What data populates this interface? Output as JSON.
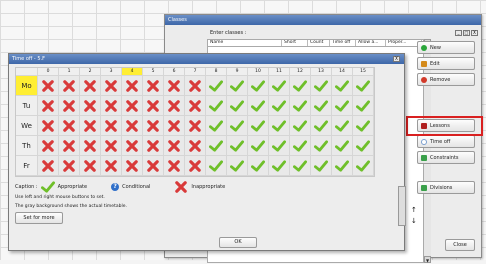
{
  "classes_window": {
    "title": "Classes",
    "enter_label": "Enter classes :",
    "columns": [
      "Name",
      "Short",
      "Count",
      "Time off",
      "Allow a...",
      "Proper..."
    ],
    "title_buttons": [
      "_",
      "□",
      "X"
    ],
    "toolbar_buttons": [
      "_",
      "□",
      "X"
    ],
    "side_buttons": [
      {
        "label": "New",
        "icon": "plus-icon",
        "color": "#2aa63a"
      },
      {
        "label": "Edit",
        "icon": "edit-icon",
        "color": "#d48a1a"
      },
      {
        "label": "Remove",
        "icon": "minus-icon",
        "color": "#d23a2a"
      },
      {
        "label": "Lessons",
        "icon": "lessons-icon",
        "color": "#b02020"
      },
      {
        "label": "Time off",
        "icon": "clock-icon",
        "color": "#7a9fd0"
      },
      {
        "label": "Constraints",
        "icon": "constraints-icon",
        "color": "#3aa04a"
      },
      {
        "label": "Divisions",
        "icon": "divisions-icon",
        "color": "#3aa04a"
      }
    ],
    "close_label": "Close",
    "up_arrow": "↑",
    "down_arrow": "↓"
  },
  "timeoff_window": {
    "title": "Time off - 5.F",
    "close_symbol": "X",
    "periods": [
      "0",
      "1",
      "2",
      "3",
      "4",
      "5",
      "6",
      "7",
      "8",
      "9",
      "10",
      "11",
      "12",
      "13",
      "14",
      "15"
    ],
    "selected_period": "4",
    "days": [
      "Mo",
      "Tu",
      "We",
      "Th",
      "Fr"
    ],
    "selected_day": "Mo",
    "grid": [
      [
        "x",
        "x",
        "x",
        "x",
        "x",
        "x",
        "x",
        "x",
        "c",
        "c",
        "c",
        "c",
        "c",
        "c",
        "c",
        "c"
      ],
      [
        "x",
        "x",
        "x",
        "x",
        "x",
        "x",
        "x",
        "x",
        "c",
        "c",
        "c",
        "c",
        "c",
        "c",
        "c",
        "c"
      ],
      [
        "x",
        "x",
        "x",
        "x",
        "x",
        "x",
        "x",
        "x",
        "c",
        "c",
        "c",
        "c",
        "c",
        "c",
        "c",
        "c"
      ],
      [
        "x",
        "x",
        "x",
        "x",
        "x",
        "x",
        "x",
        "x",
        "c",
        "c",
        "c",
        "c",
        "c",
        "c",
        "c",
        "c"
      ],
      [
        "x",
        "x",
        "x",
        "x",
        "x",
        "x",
        "x",
        "x",
        "c",
        "c",
        "c",
        "c",
        "c",
        "c",
        "c",
        "c"
      ]
    ],
    "caption_label": "Caption :",
    "caption_items": [
      "Appropriate",
      "Conditional",
      "Inappropriate"
    ],
    "note1": "Use left and right mouse buttons to set.",
    "note2": "The gray background shows the actual timetable.",
    "set_more_label": "Set for more",
    "ok_label": "OK"
  },
  "colors": {
    "highlight": "#ffee33",
    "check": "#6fbf2a",
    "cross": "#d93a3a",
    "annotation": "#d92020"
  }
}
